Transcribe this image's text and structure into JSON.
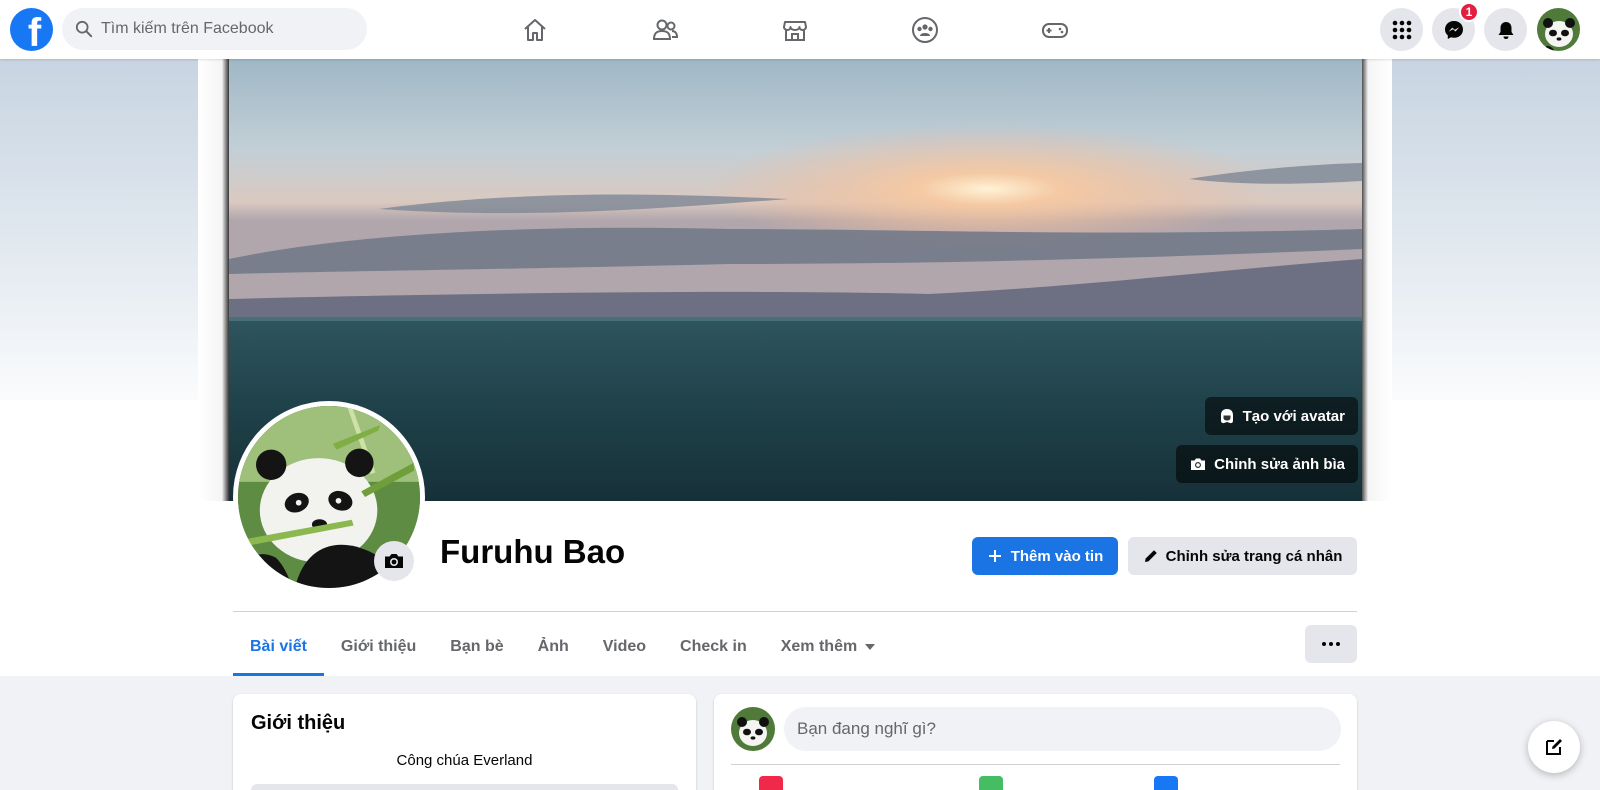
{
  "nav": {
    "search_placeholder": "Tìm kiếm trên Facebook",
    "logo_letter": "f",
    "messenger_badge": "1",
    "icons": [
      "home-icon",
      "friends-icon",
      "marketplace-icon",
      "groups-icon",
      "gaming-icon"
    ],
    "right_icons": [
      "menu-grid-icon",
      "messenger-icon",
      "notifications-icon",
      "account-avatar"
    ]
  },
  "cover": {
    "create_avatar_label": "Tạo với avatar",
    "edit_cover_label": "Chỉnh sửa ảnh bìa"
  },
  "profile": {
    "name": "Furuhu Bao",
    "add_story_label": "Thêm vào tin",
    "edit_profile_label": "Chỉnh sửa trang cá nhân"
  },
  "tabs": [
    {
      "label": "Bài viết",
      "active": true
    },
    {
      "label": "Giới thiệu"
    },
    {
      "label": "Bạn bè"
    },
    {
      "label": "Ảnh"
    },
    {
      "label": "Video"
    },
    {
      "label": "Check in"
    },
    {
      "label": "Xem thêm"
    }
  ],
  "intro": {
    "title": "Giới thiệu",
    "bio": "Công chúa Everland"
  },
  "composer": {
    "placeholder": "Bạn đang nghĩ gì?"
  },
  "colors": {
    "brand_blue": "#1877f2",
    "button_blue": "#1b74e4",
    "badge_red": "#e41e3f",
    "secondary_gray": "#e4e6eb"
  }
}
